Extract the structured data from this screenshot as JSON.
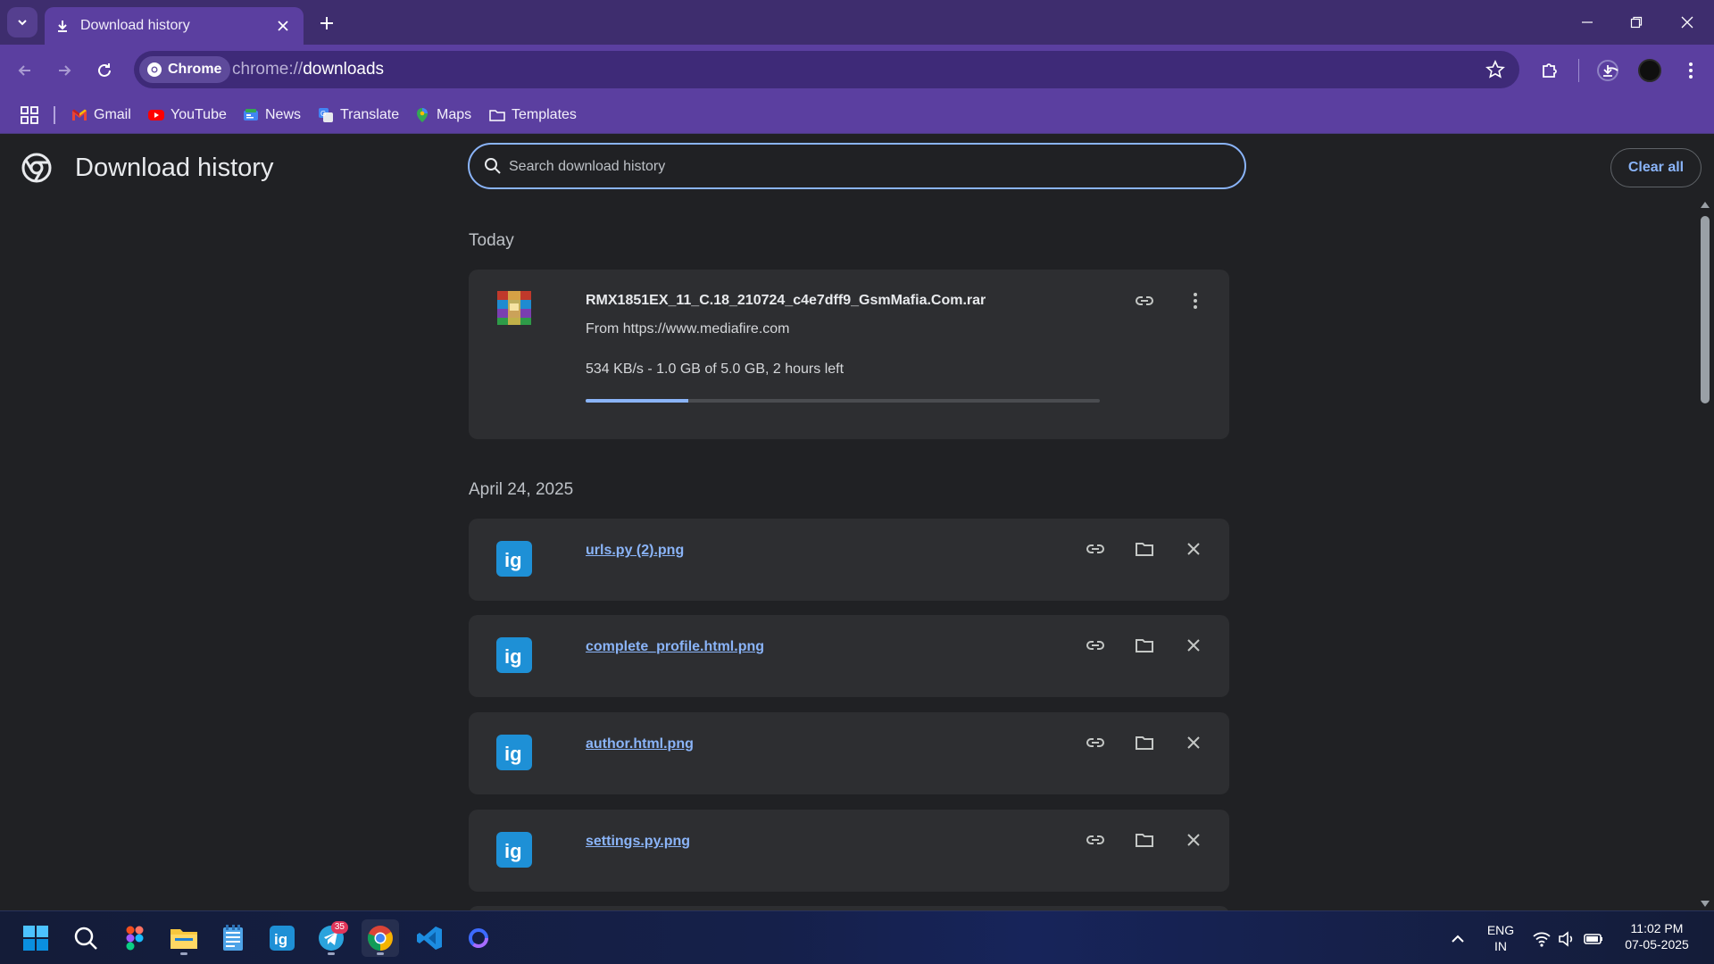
{
  "browser": {
    "tab_title": "Download history",
    "omnibox_chip": "Chrome",
    "url_scheme": "chrome://",
    "url_host": "downloads"
  },
  "bookmarks": [
    "Gmail",
    "YouTube",
    "News",
    "Translate",
    "Maps",
    "Templates"
  ],
  "page": {
    "title": "Download history",
    "search_placeholder": "Search download history",
    "clear_all": "Clear all"
  },
  "sections": [
    {
      "date": "Today",
      "items": [
        {
          "name": "RMX1851EX_11_C.18_210724_c4e7dff9_GsmMafia.Com.rar",
          "source": "From https://www.mediafire.com",
          "status": "534 KB/s - 1.0 GB of 5.0 GB, 2 hours left",
          "progress_percent": 20
        }
      ]
    },
    {
      "date": "April 24, 2025",
      "items": [
        {
          "name": "urls.py (2).png"
        },
        {
          "name": "complete_profile.html.png"
        },
        {
          "name": "author.html.png"
        },
        {
          "name": "settings.py.png"
        }
      ]
    }
  ],
  "taskbar": {
    "telegram_badge": "35",
    "lang_line1": "ENG",
    "lang_line2": "IN",
    "time": "11:02 PM",
    "date": "07-05-2025"
  },
  "colors": {
    "accent": "#8ab4f8",
    "frame": "#5b3fa0",
    "page_bg": "#202124",
    "card_bg": "#2d2e31"
  }
}
